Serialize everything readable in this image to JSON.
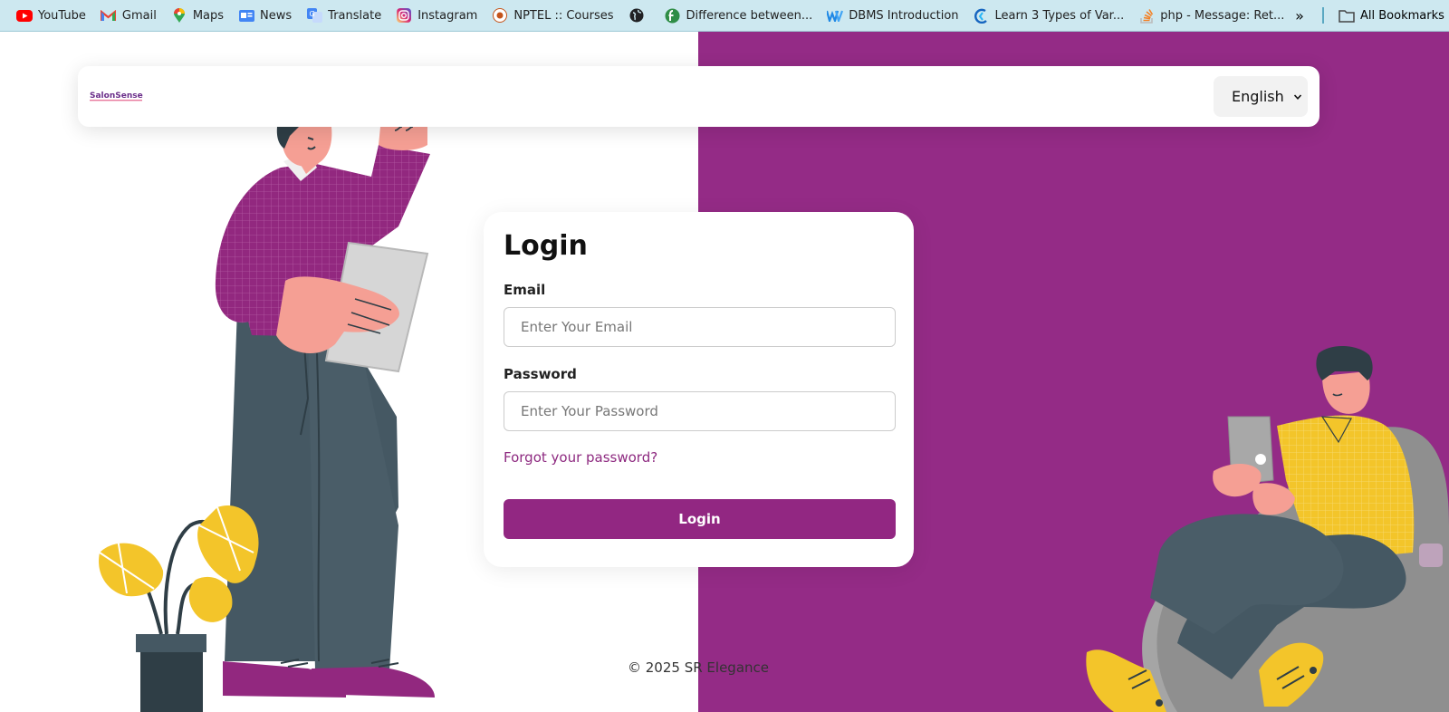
{
  "bookmarks_bar": {
    "items": [
      {
        "label": "YouTube",
        "icon": "youtube-icon"
      },
      {
        "label": "Gmail",
        "icon": "gmail-icon"
      },
      {
        "label": "Maps",
        "icon": "maps-icon"
      },
      {
        "label": "News",
        "icon": "news-icon"
      },
      {
        "label": "Translate",
        "icon": "translate-icon"
      },
      {
        "label": "Instagram",
        "icon": "instagram-icon"
      },
      {
        "label": "NPTEL :: Courses",
        "icon": "nptel-icon"
      },
      {
        "label": "",
        "icon": "globe-icon"
      },
      {
        "label": "Difference between...",
        "icon": "gfg-icon"
      },
      {
        "label": "DBMS Introduction",
        "icon": "dbms-icon"
      },
      {
        "label": "Learn 3 Types of Var...",
        "icon": "learn-icon"
      },
      {
        "label": "php - Message: Ret...",
        "icon": "stackoverflow-icon"
      }
    ],
    "more_label": "»",
    "all_bookmarks_label": "All Bookmarks"
  },
  "header": {
    "logo_text": "SalonSense",
    "language_label": "English"
  },
  "login": {
    "title": "Login",
    "email_label": "Email",
    "email_placeholder": "Enter Your Email",
    "email_value": "",
    "password_label": "Password",
    "password_placeholder": "Enter Your Password",
    "password_value": "",
    "forgot_label": "Forgot your password?",
    "submit_label": "Login"
  },
  "footer": {
    "copyright": "© 2025 SR Elegance"
  },
  "colors": {
    "brand_purple": "#942b86",
    "button_purple": "#922782",
    "bookmarks_bg": "#cde8f0"
  }
}
